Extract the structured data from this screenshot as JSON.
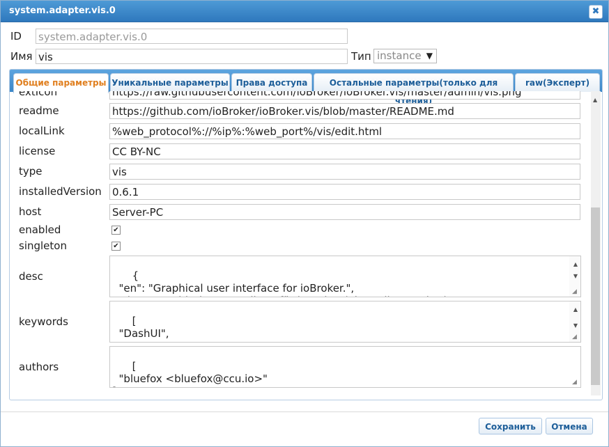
{
  "dialog": {
    "title": "system.adapter.vis.0",
    "close_glyph": "✖"
  },
  "header": {
    "id_label": "ID",
    "id_value": "system.adapter.vis.0",
    "name_label": "Имя",
    "name_value": "vis",
    "type_label": "Тип",
    "type_value": "instance"
  },
  "tabs": [
    {
      "label": "Общие параметры",
      "active": true
    },
    {
      "label": "Уникальные параметры"
    },
    {
      "label": "Права доступа"
    },
    {
      "label": "Остальные параметры(только для чтения)"
    },
    {
      "label": "raw(Эксперт)"
    }
  ],
  "fields": {
    "extIcon": {
      "label": "extIcon",
      "value": "https://raw.githubusercontent.com/ioBroker/ioBroker.vis/master/admin/vis.png"
    },
    "readme": {
      "label": "readme",
      "value": "https://github.com/ioBroker/ioBroker.vis/blob/master/README.md"
    },
    "localLink": {
      "label": "localLink",
      "value": "%web_protocol%://%ip%:%web_port%/vis/edit.html"
    },
    "license": {
      "label": "license",
      "value": "CC BY-NC"
    },
    "type": {
      "label": "type",
      "value": "vis"
    },
    "installedVersion": {
      "label": "installedVersion",
      "value": "0.6.1"
    },
    "host": {
      "label": "host",
      "value": "Server-PC"
    },
    "enabled": {
      "label": "enabled",
      "checked": true
    },
    "singleton": {
      "label": "singleton",
      "checked": true
    },
    "desc": {
      "label": "desc",
      "value": "{\n  \"en\": \"Graphical user interface for ioBroker.\",\n  \"de\": \"Graphische Darstellung für ioBroker (ehemalige DashUI)\","
    },
    "keywords": {
      "label": "keywords",
      "value": "[\n  \"DashUI\",\n  \"GUI\","
    },
    "authors": {
      "label": "authors",
      "value": "[\n  \"bluefox <bluefox@ccu.io>\"\n]"
    }
  },
  "buttons": {
    "save": "Сохранить",
    "cancel": "Отмена"
  },
  "icons": {
    "checkbox": "check-icon",
    "close": "close-icon"
  }
}
